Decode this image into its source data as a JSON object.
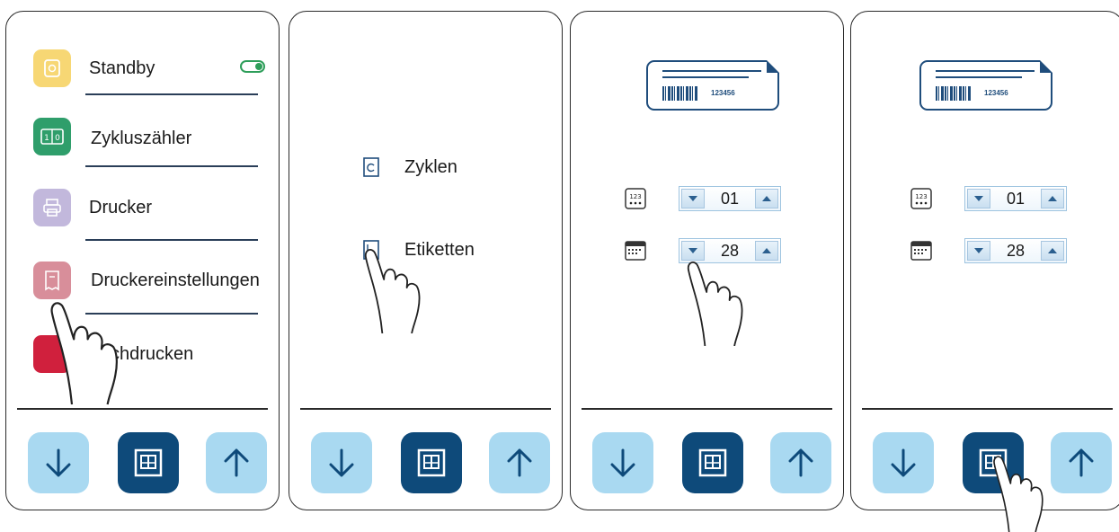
{
  "panels": {
    "p1": {
      "menu": [
        {
          "label": "Standby",
          "icon": "power-icon",
          "color": "#f7d774"
        },
        {
          "label": "Zykluszähler",
          "icon": "counter-icon",
          "color": "#2f9e6b"
        },
        {
          "label": "Drucker",
          "icon": "printer-icon",
          "color": "#c2b8dc"
        },
        {
          "label": "Druckereinstellungen",
          "icon": "receipt-icon",
          "color": "#d88e9a"
        },
        {
          "label": "chdrucken",
          "icon": "reprint-icon",
          "color": "#d0203d"
        }
      ],
      "standby_toggle_on": true
    },
    "p2": {
      "submenu": [
        {
          "label": "Zyklen",
          "icon": "cycle-receipt-icon"
        },
        {
          "label": "Etiketten",
          "icon": "label-icon"
        }
      ]
    },
    "p3": {
      "label_number": "123456",
      "stepper_count": "01",
      "stepper_date": "28"
    },
    "p4": {
      "label_number": "123456",
      "stepper_count": "01",
      "stepper_date": "28"
    }
  },
  "colors": {
    "nav_light": "#a9d9f1",
    "nav_dark": "#0e4a7a",
    "accent": "#1f4d7c"
  },
  "nav_icons": [
    "arrow-down-icon",
    "print-label-icon",
    "arrow-up-icon"
  ]
}
